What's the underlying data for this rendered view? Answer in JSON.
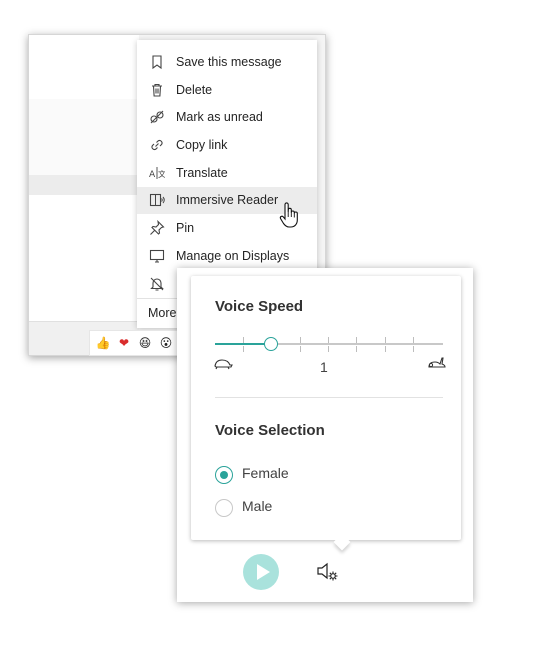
{
  "context_menu": {
    "items": [
      {
        "label": "Save this message",
        "icon": "bookmark-icon"
      },
      {
        "label": "Delete",
        "icon": "trash-icon"
      },
      {
        "label": "Mark as unread",
        "icon": "unread-icon"
      },
      {
        "label": "Copy link",
        "icon": "link-icon"
      },
      {
        "label": "Translate",
        "icon": "translate-icon"
      },
      {
        "label": "Immersive Reader",
        "icon": "immersive-reader-icon",
        "highlighted": true
      },
      {
        "label": "Pin",
        "icon": "pin-icon"
      },
      {
        "label": "Manage on Displays",
        "icon": "display-icon"
      },
      {
        "label": "",
        "icon": "mute-bell-icon"
      }
    ],
    "more_label": "More"
  },
  "reactions": [
    "👍",
    "❤",
    "😆",
    "😮"
  ],
  "voice_panel": {
    "speed_title": "Voice Speed",
    "speed_value": "1",
    "speed_level_fraction": 0.22,
    "selection_title": "Voice Selection",
    "options": [
      {
        "label": "Female",
        "selected": true
      },
      {
        "label": "Male",
        "selected": false
      }
    ]
  },
  "colors": {
    "accent": "#2aa39a",
    "play_button": "#a9e2dc"
  }
}
